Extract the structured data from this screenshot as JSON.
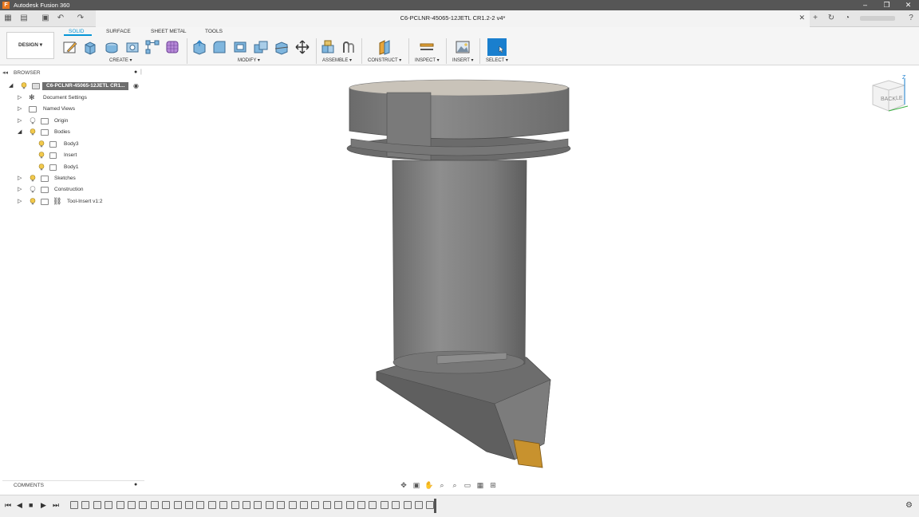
{
  "window": {
    "title": "Autodesk Fusion 360",
    "logo": "F"
  },
  "document": {
    "title": "C6-PCLNR-45065-12JETL CR1.2-2 v4*"
  },
  "workspace": {
    "label": "DESIGN ▾"
  },
  "tabs": [
    "SOLID",
    "SURFACE",
    "SHEET METAL",
    "TOOLS"
  ],
  "toolbar_groups": [
    "CREATE ▾",
    "MODIFY ▾",
    "ASSEMBLE ▾",
    "CONSTRUCT ▾",
    "INSPECT ▾",
    "INSERT ▾",
    "SELECT ▾"
  ],
  "browser": {
    "title": "BROWSER",
    "root": "C6-PCLNR-45065-12JETL CR1...",
    "items": [
      "Document Settings",
      "Named Views",
      "Origin",
      "Bodies",
      "Body3",
      "Insert",
      "Body1",
      "Sketches",
      "Construction",
      "Tool-Insert v1:2"
    ]
  },
  "comments": {
    "label": "COMMENTS"
  },
  "viewcube": {
    "face_back": "BACK",
    "face_left": "LE",
    "axis_z": "Z"
  },
  "colors": {
    "accent": "#0696d7",
    "select_btn": "#1a7fce",
    "model_gray": "#7e7e7e",
    "insert_gold": "#c8922e"
  }
}
